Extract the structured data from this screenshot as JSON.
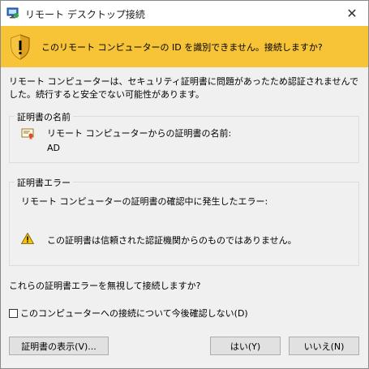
{
  "window": {
    "title": "リモート デスクトップ接続",
    "close_glyph": "✕"
  },
  "banner": {
    "message": "このリモート コンピューターの ID を識別できません。接続しますか?",
    "color": "#f7c438"
  },
  "intro": "リモート コンピューターは、セキュリティ証明書に問題があったため認証されませんでした。続行すると安全でない可能性があります。",
  "cert_name_group": {
    "legend": "証明書の名前",
    "label": "リモート コンピューターからの証明書の名前:",
    "value": "AD",
    "icon": "certificate-icon"
  },
  "cert_error_group": {
    "legend": "証明書エラー",
    "label": "リモート コンピューターの証明書の確認中に発生したエラー:",
    "error": "この証明書は信頼された認証機関からのものではありません。",
    "icon": "warning-icon"
  },
  "question": "これらの証明書エラーを無視して接続しますか?",
  "dont_ask_checkbox": {
    "label": "このコンピューターへの接続について今後確認しない(D)",
    "checked": false
  },
  "buttons": {
    "view_cert": "証明書の表示(V)...",
    "yes": "はい(Y)",
    "no": "いいえ(N)"
  }
}
